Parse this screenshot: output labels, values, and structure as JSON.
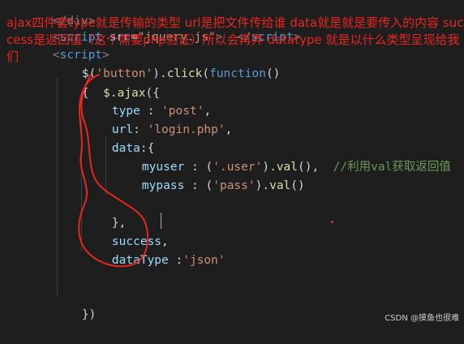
{
  "annotation": {
    "text": "ajax四件套type就是传输的类型 url是把文件传给谁 data就是就是要传入的内容 success是返回值（这个需要php验证）所以会再弄 datatype 就是以什么类型呈现给我们",
    "color": "#e8261f"
  },
  "code": {
    "line0": {
      "text": "</div>"
    },
    "line1": {
      "lt": "<",
      "tag": "script",
      "attr": "src",
      "eq": "=",
      "val": "\"jquery.js\"",
      "gt": ">",
      "close_lt": "</",
      "close_tag": "script",
      "close_gt": ">"
    },
    "line2": {
      "lt": "<",
      "tag": "script",
      "gt": ">"
    },
    "line3": {
      "pre": "$(",
      "arg": "'button'",
      "mid": ").",
      "fn": "click",
      "open": "(",
      "kw": "function",
      "close": "()"
    },
    "line4": {
      "open": "{",
      "fn": "$.ajax",
      "paren": "({"
    },
    "line5": {
      "key": "type",
      "colon": " : ",
      "val": "'post'",
      "comma": ","
    },
    "line6": {
      "key": "url",
      "colon": ": ",
      "val": "'login.php'",
      "comma": ","
    },
    "line7": {
      "key": "data",
      "colon": ":{"
    },
    "line8": {
      "key": "myuser",
      "colon": " : (",
      "val": "'.user'",
      "mid": ").",
      "fn": "val",
      "end": "(),",
      "comment": "//利用val获取返回值"
    },
    "line9": {
      "key": "mypass",
      "colon": " : (",
      "val": "'pass'",
      "mid": ").",
      "fn": "val",
      "end": "()"
    },
    "line11": {
      "text": "},"
    },
    "line12": {
      "key": "success",
      "comma": ","
    },
    "line13": {
      "key": "dataType",
      "colon": " :",
      "val": "'json'"
    },
    "line15": {
      "text": "})"
    }
  },
  "watermark": "CSDN @摸鱼也很难"
}
